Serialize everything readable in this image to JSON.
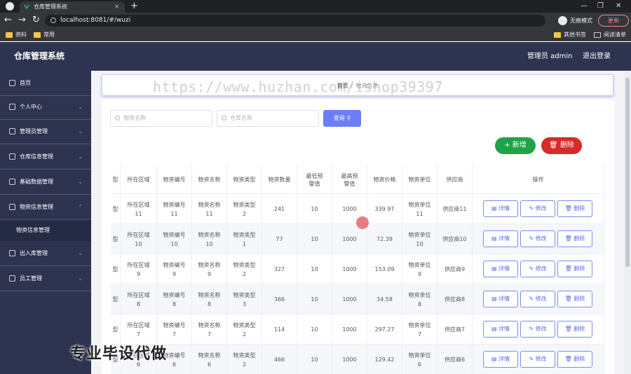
{
  "browser": {
    "tab_title": "仓库管理系统",
    "url": "localhost:8081/#/wuzi",
    "incognito_label": "无痕模式",
    "update_label": "更新",
    "bookmarks_left": [
      "资料",
      "常用"
    ],
    "bookmarks_right": [
      "其他书签",
      "阅读清单"
    ]
  },
  "header": {
    "app_title": "仓库管理系统",
    "user": "管理员 admin",
    "logout": "退出登录"
  },
  "sidebar": {
    "items": [
      {
        "label": "首页"
      },
      {
        "label": "个人中心"
      },
      {
        "label": "管理员管理"
      },
      {
        "label": "仓库信息管理"
      },
      {
        "label": "基础数据管理"
      },
      {
        "label": "物资信息管理"
      },
      {
        "label": "出入库管理"
      },
      {
        "label": "员工管理"
      }
    ],
    "sub_item": "物资信息管理"
  },
  "breadcrumb": {
    "home": "首页",
    "current": "物资信息"
  },
  "search": {
    "material_placeholder": "物资名称",
    "warehouse_placeholder": "仓库名称",
    "button": "查询"
  },
  "actions": {
    "add": "+ 新增",
    "delete": "删除"
  },
  "table": {
    "columns": [
      "型",
      "所在区域",
      "物资编号",
      "物资名称",
      "物资类型",
      "物资数量",
      "最低预警值",
      "最高预警值",
      "物资价格",
      "物资单位",
      "供应商",
      "操作"
    ],
    "row_buttons": {
      "detail": "详情",
      "edit": "修改",
      "delete": "删除"
    },
    "rows": [
      {
        "c0": "型",
        "area": "所在区域11",
        "code": "物资编号11",
        "name": "物资名称11",
        "type": "物资类型2",
        "qty": "241",
        "min": "10",
        "max": "1000",
        "price": "339.97",
        "unit": "物资单位11",
        "supplier": "供应商11"
      },
      {
        "c0": "型",
        "area": "所在区域10",
        "code": "物资编号10",
        "name": "物资名称10",
        "type": "物资类型1",
        "qty": "77",
        "min": "10",
        "max": "1000",
        "price": "72.39",
        "unit": "物资单位10",
        "supplier": "供应商10"
      },
      {
        "c0": "型",
        "area": "所在区域9",
        "code": "物资编号9",
        "name": "物资名称9",
        "type": "物资类型2",
        "qty": "327",
        "min": "10",
        "max": "1000",
        "price": "153.09",
        "unit": "物资单位9",
        "supplier": "供应商9"
      },
      {
        "c0": "型",
        "area": "所在区域8",
        "code": "物资编号8",
        "name": "物资名称8",
        "type": "物资类型3",
        "qty": "366",
        "min": "10",
        "max": "1000",
        "price": "34.58",
        "unit": "物资单位8",
        "supplier": "供应商8"
      },
      {
        "c0": "型",
        "area": "所在区域7",
        "code": "物资编号7",
        "name": "物资名称7",
        "type": "物资类型2",
        "qty": "114",
        "min": "10",
        "max": "1000",
        "price": "297.27",
        "unit": "物资单位7",
        "supplier": "供应商7"
      },
      {
        "c0": "型",
        "area": "所在区域6",
        "code": "物资编号6",
        "name": "物资名称6",
        "type": "物资类型2",
        "qty": "466",
        "min": "10",
        "max": "1000",
        "price": "129.42",
        "unit": "物资单位6",
        "supplier": "供应商6"
      }
    ]
  },
  "watermark": "https://www.huzhan.com/ishop39397",
  "overlay_text": "专业毕设代做"
}
